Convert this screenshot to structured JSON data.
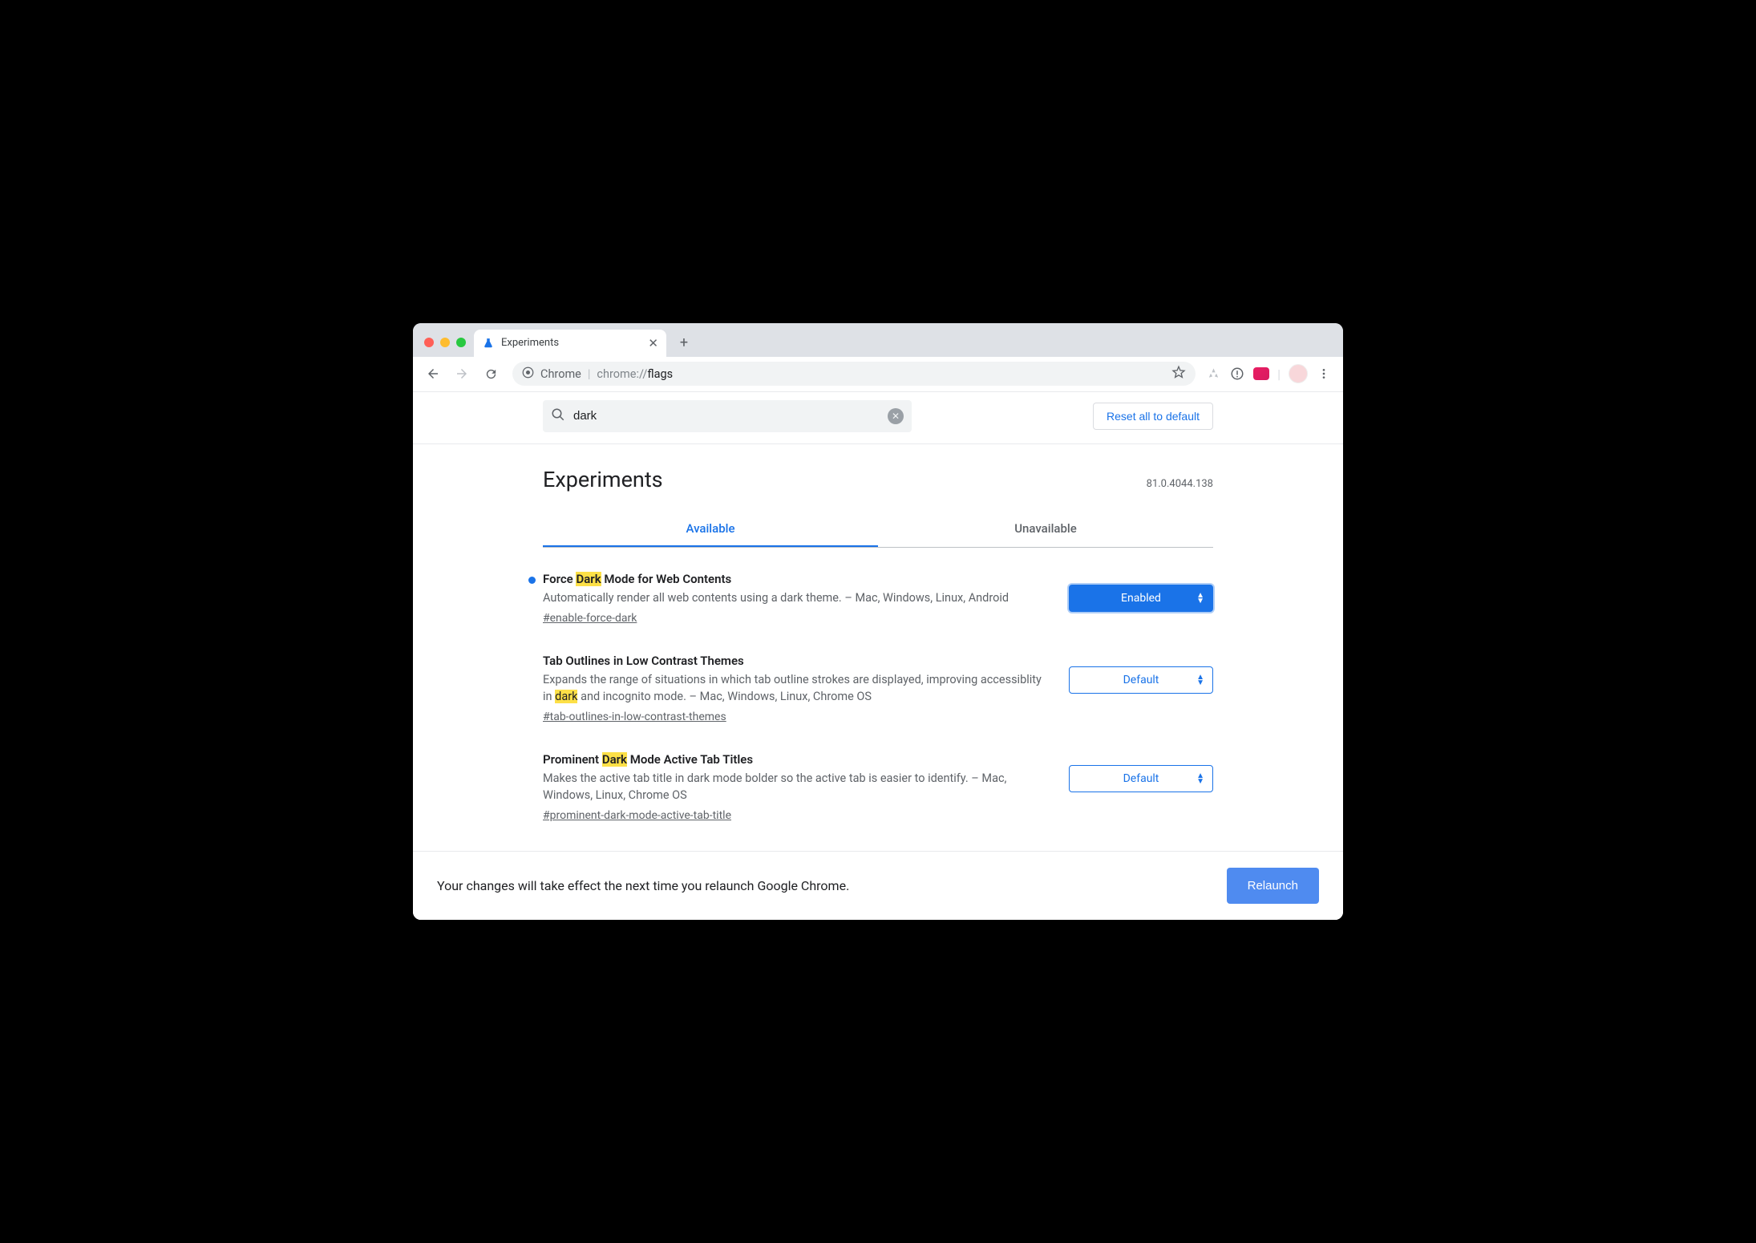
{
  "browser": {
    "tab_title": "Experiments",
    "omnibox": {
      "chip": "Chrome",
      "url_path": "chrome://",
      "url_rest": "flags"
    }
  },
  "search": {
    "value": "dark",
    "reset_label": "Reset all to default"
  },
  "page_title": "Experiments",
  "version": "81.0.4044.138",
  "tabs": {
    "available": "Available",
    "unavailable": "Unavailable"
  },
  "experiments": [
    {
      "modified": true,
      "title_pre": "Force ",
      "title_hl": "Dark",
      "title_post": " Mode for Web Contents",
      "desc_pre": "Automatically render all web contents using a dark theme. – Mac, Windows, Linux, Android",
      "desc_hl": "",
      "desc_post": "",
      "tag": "#enable-force-dark",
      "select_value": "Enabled",
      "select_style": "enabled"
    },
    {
      "modified": false,
      "title_pre": "Tab Outlines in Low Contrast Themes",
      "title_hl": "",
      "title_post": "",
      "desc_pre": "Expands the range of situations in which tab outline strokes are displayed, improving accessiblity in ",
      "desc_hl": "dark",
      "desc_post": " and incognito mode. – Mac, Windows, Linux, Chrome OS",
      "tag": "#tab-outlines-in-low-contrast-themes",
      "select_value": "Default",
      "select_style": "default"
    },
    {
      "modified": false,
      "title_pre": "Prominent ",
      "title_hl": "Dark",
      "title_post": " Mode Active Tab Titles",
      "desc_pre": "Makes the active tab title in dark mode bolder so the active tab is easier to identify. – Mac, Windows, Linux, Chrome OS",
      "desc_hl": "",
      "desc_post": "",
      "tag": "#prominent-dark-mode-active-tab-title",
      "select_value": "Default",
      "select_style": "default"
    }
  ],
  "relaunch": {
    "message": "Your changes will take effect the next time you relaunch Google Chrome.",
    "button": "Relaunch"
  }
}
